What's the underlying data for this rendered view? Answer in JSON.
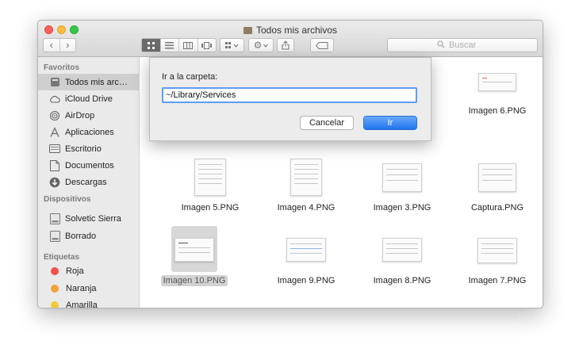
{
  "window": {
    "title": "Todos mis archivos"
  },
  "toolbar": {
    "back": "‹",
    "forward": "›",
    "search_placeholder": "Buscar"
  },
  "sidebar": {
    "sections": {
      "favorites": "Favoritos",
      "devices": "Dispositivos",
      "tags": "Etiquetas"
    },
    "favorites": [
      {
        "label": "Todos mis arc…",
        "icon": "all-files-icon",
        "selected": true
      },
      {
        "label": "iCloud Drive",
        "icon": "cloud-icon"
      },
      {
        "label": "AirDrop",
        "icon": "airdrop-icon"
      },
      {
        "label": "Aplicaciones",
        "icon": "applications-icon"
      },
      {
        "label": "Escritorio",
        "icon": "desktop-icon"
      },
      {
        "label": "Documentos",
        "icon": "documents-icon"
      },
      {
        "label": "Descargas",
        "icon": "downloads-icon"
      }
    ],
    "devices": [
      {
        "label": "Solvetic Sierra",
        "icon": "disk-icon"
      },
      {
        "label": "Borrado",
        "icon": "disk-icon"
      }
    ],
    "tags": [
      {
        "label": "Roja",
        "color": "#f0514b"
      },
      {
        "label": "Naranja",
        "color": "#f4a03a"
      },
      {
        "label": "Amarilla",
        "color": "#f3c93b"
      }
    ]
  },
  "files": [
    "Imagen 6.PNG",
    "Imagen 5.PNG",
    "Imagen 4.PNG",
    "Imagen 3.PNG",
    "Captura.PNG",
    "Imagen 10.PNG",
    "Imagen 9.PNG",
    "Imagen 8.PNG",
    "Imagen 7.PNG"
  ],
  "selected_file": "Imagen 10.PNG",
  "dialog": {
    "label": "Ir a la carpeta:",
    "path_value": "~/Library/Services",
    "cancel_label": "Cancelar",
    "go_label": "Ir"
  },
  "colors": {
    "accent": "#1f74ee",
    "focus_ring": "#5c9df0"
  }
}
